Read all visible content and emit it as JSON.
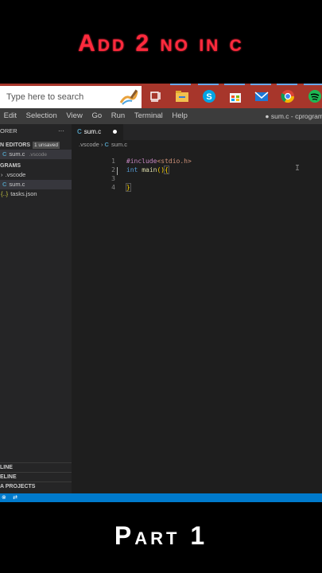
{
  "overlay": {
    "top_title": "Add 2 no in c",
    "bottom_title": "Part 1"
  },
  "taskbar": {
    "search_placeholder": "Type here to search",
    "icons": [
      "task-view-icon",
      "file-explorer-icon",
      "skype-icon",
      "store-icon",
      "mail-icon",
      "chrome-icon",
      "spotify-icon"
    ],
    "accent_color": "#a7362b"
  },
  "menubar": {
    "items": [
      "Edit",
      "Selection",
      "View",
      "Go",
      "Run",
      "Terminal",
      "Help"
    ],
    "window_title": "● sum.c - cprogram"
  },
  "sidebar": {
    "explorer_label": "ORER",
    "open_editors_label": "N EDITORS",
    "unsaved_badge": "1 unsaved",
    "open_file_icon": "C",
    "open_file": "sum.c",
    "open_file_folder": ".vscode",
    "folder_label": "GRAMS",
    "tree": [
      {
        "icon": "",
        "name": ".vscode"
      },
      {
        "icon": "C",
        "name": "sum.c"
      },
      {
        "icon": "{..}",
        "name": "tasks.json"
      }
    ],
    "bottom_sections": [
      "LINE",
      "ELINE",
      "A PROJECTS"
    ]
  },
  "editor": {
    "tab_label": "sum.c",
    "breadcrumb_folder": ".vscode",
    "breadcrumb_file": "sum.c",
    "lines": [
      {
        "num": "1",
        "include": "#include",
        "header": "<stdio.h>"
      },
      {
        "num": "2",
        "type": "int",
        "fn": "main",
        "paren": "()",
        "brace": "{"
      },
      {
        "num": "3"
      },
      {
        "num": "4",
        "brace": "}"
      }
    ]
  },
  "statusbar": {
    "color": "#007acc"
  }
}
